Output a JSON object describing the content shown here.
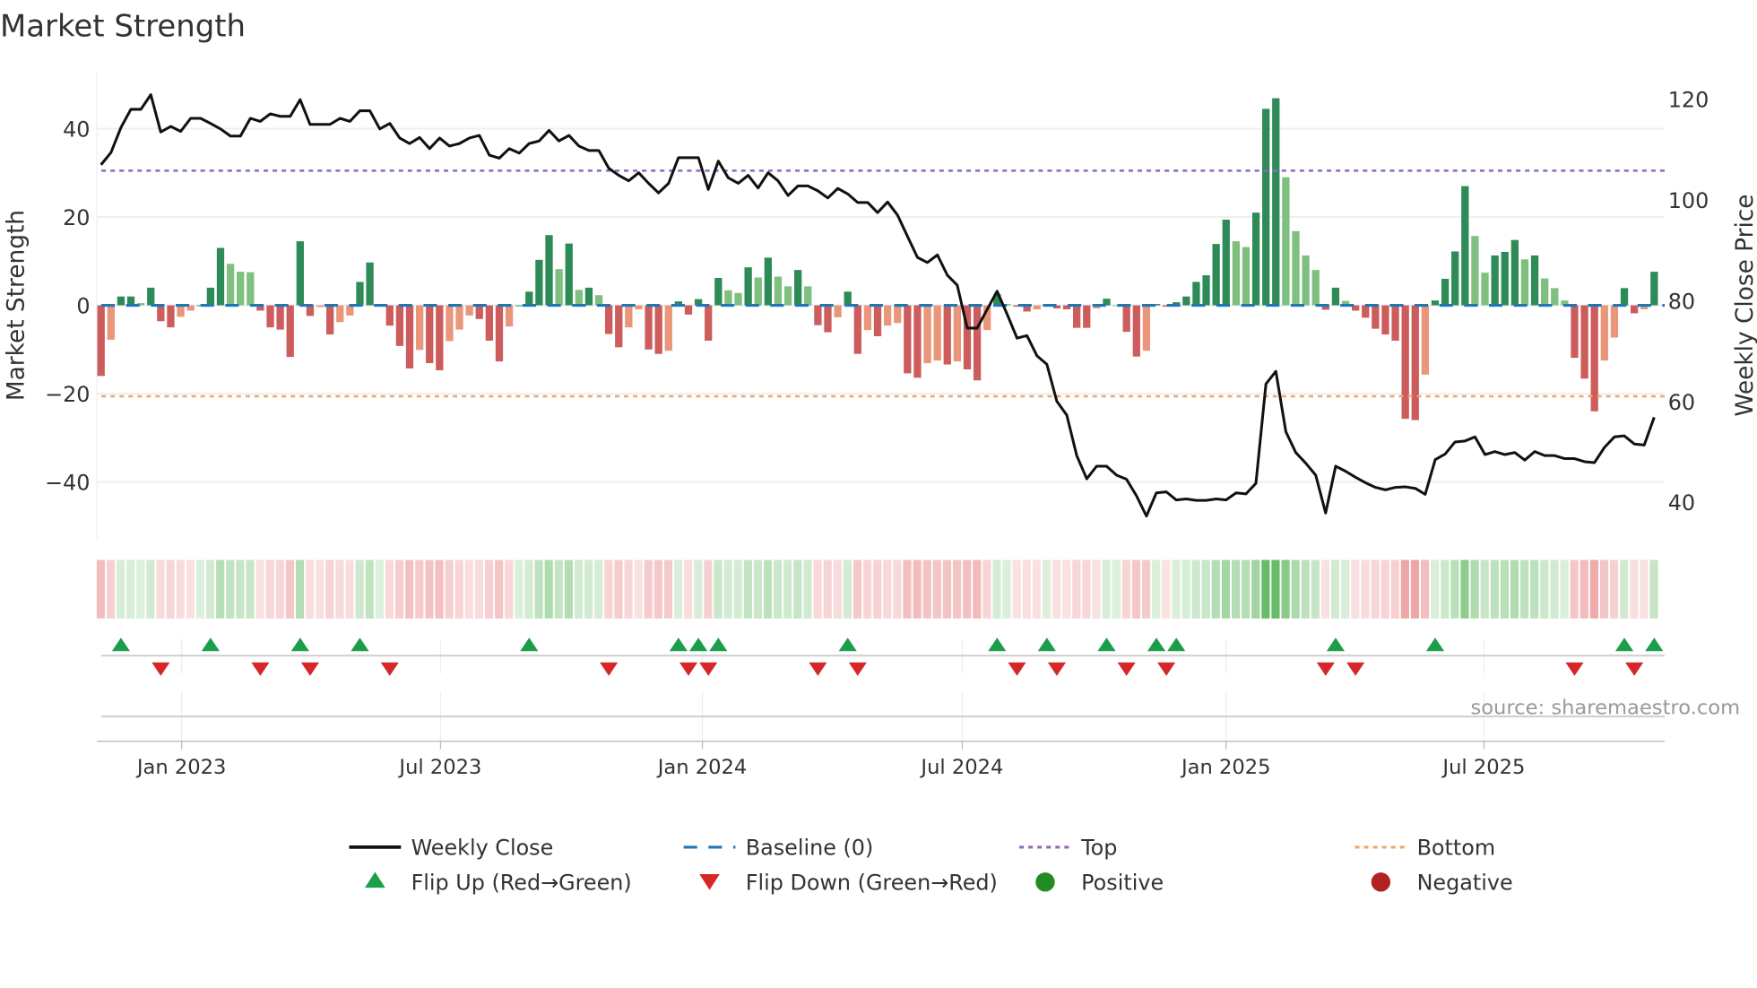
{
  "chart_data": {
    "type": "bar",
    "title": "Market Strength",
    "ylabel": "Market Strength",
    "y2label": "Weekly Close Price",
    "ylim": [
      -53,
      53
    ],
    "y2lim": [
      36,
      124
    ],
    "yticks": [
      40,
      20,
      0,
      -20,
      -40
    ],
    "yticks_labels": [
      "40",
      "20",
      "0",
      "−20",
      "−40"
    ],
    "y2ticks": [
      120,
      100,
      80,
      60,
      40
    ],
    "y2ticks_labels": [
      "120",
      "100",
      "80",
      "60",
      "40"
    ],
    "x_start": "2022-10-28",
    "x_interval": "weekly",
    "xticks": [
      {
        "label": "Jan 2023",
        "week": 9.1
      },
      {
        "label": "Jul 2023",
        "week": 35.1
      },
      {
        "label": "Jan 2024",
        "week": 61.4
      },
      {
        "label": "Jul 2024",
        "week": 87.5
      },
      {
        "label": "Jan 2025",
        "week": 114.0
      },
      {
        "label": "Jul 2025",
        "week": 139.9
      }
    ],
    "top_level": 30.5,
    "bottom_level": -20.6,
    "baseline": 0,
    "strength": [
      -16,
      -7.8,
      2,
      2,
      0.5,
      4,
      -3.6,
      -5,
      -2.6,
      -1.2,
      0,
      4,
      13,
      9.4,
      7.6,
      7.5,
      -1.2,
      -5,
      -5.5,
      -11.7,
      14.5,
      -2.4,
      -0.4,
      -6.6,
      -3.8,
      -2.3,
      5.3,
      9.7,
      0,
      -4.6,
      -9.2,
      -14.3,
      -10.1,
      -13.1,
      -14.7,
      -8.1,
      -5.5,
      -2.3,
      -3.1,
      -8,
      -12.7,
      -4.8,
      0,
      3.1,
      10.3,
      15.9,
      8.2,
      14,
      3.5,
      4,
      2.3,
      -6.5,
      -9.5,
      -5,
      -0.9,
      -10,
      -11,
      -10.3,
      0.9,
      -2.1,
      1.4,
      -8,
      6.2,
      3.4,
      2.8,
      8.6,
      6.3,
      10.8,
      6.5,
      4.3,
      8,
      4.3,
      -4.5,
      -6.1,
      -2.7,
      3.1,
      -11,
      -5.6,
      -7,
      -4.6,
      -4,
      -15.4,
      -16.4,
      -13.1,
      -12.5,
      -13.4,
      -12.7,
      -14.5,
      -17,
      -5.6,
      2.5,
      0.3,
      -0.3,
      -1.4,
      -0.9,
      0.3,
      -0.7,
      -0.9,
      -5.1,
      -5.1,
      -0.7,
      1.5,
      0,
      -6,
      -11.6,
      -10.3,
      0.3,
      -0.3,
      0.7,
      2,
      5.3,
      6.8,
      13.9,
      19.4,
      14.5,
      13.2,
      21,
      44.5,
      46.9,
      29,
      16.8,
      11.3,
      8,
      -1,
      4,
      1,
      -1.2,
      -2.8,
      -5.3,
      -6.6,
      -8,
      -25.7,
      -26,
      -15.7,
      1.1,
      6,
      12.2,
      27,
      15.7,
      7.4,
      11.3,
      12.1,
      14.8,
      10.4,
      11.3,
      6.1,
      3.9,
      1.1,
      -11.9,
      -16.6,
      -24,
      -12.5,
      -7.3,
      3.9,
      -1.8,
      -0.9,
      7.6
    ],
    "weekly_close": [
      107,
      109.4,
      114.4,
      118,
      118,
      120.9,
      113.5,
      114.6,
      113.6,
      116.2,
      116.2,
      115.2,
      114.1,
      112.7,
      112.7,
      116.2,
      115.6,
      117.1,
      116.6,
      116.6,
      119.9,
      115,
      115,
      115,
      116.2,
      115.6,
      117.7,
      117.7,
      114.1,
      115.2,
      112.3,
      111.2,
      112.4,
      110.2,
      112.3,
      110.7,
      111.2,
      112.3,
      112.8,
      108.9,
      108.3,
      110.2,
      109.3,
      111.2,
      111.7,
      113.8,
      111.7,
      112.8,
      110.7,
      109.8,
      109.8,
      106.3,
      104.9,
      103.8,
      105.4,
      103.3,
      101.4,
      103.3,
      108.4,
      108.4,
      108.4,
      102.1,
      107.7,
      104.4,
      103.3,
      104.9,
      102.4,
      105.4,
      103.8,
      100.9,
      102.8,
      102.8,
      101.8,
      100.4,
      102.3,
      101.2,
      99.5,
      99.5,
      97.5,
      99.6,
      97,
      92.8,
      88.6,
      87.6,
      89.1,
      85.1,
      83.1,
      74.6,
      74.6,
      78.3,
      81.9,
      77.4,
      72.6,
      73.1,
      69.1,
      67.4,
      60.1,
      57.3,
      49.3,
      44.7,
      47.2,
      47.2,
      45.4,
      44.6,
      41.3,
      37.3,
      41.9,
      42.1,
      40.5,
      40.7,
      40.4,
      40.4,
      40.7,
      40.5,
      41.9,
      41.7,
      43.8,
      63.5,
      66,
      54,
      49.9,
      47.8,
      45.4,
      37.9,
      47.2,
      46.2,
      45,
      43.9,
      43,
      42.5,
      43,
      43.1,
      42.8,
      41.6,
      48.5,
      49.6,
      52,
      52.2,
      53,
      49.5,
      50.1,
      49.5,
      49.9,
      48.4,
      50.1,
      49.3,
      49.3,
      48.7,
      48.7,
      48.1,
      47.9,
      50.9,
      53,
      53.2,
      51.6,
      51.4,
      56.9
    ],
    "flip_up_weeks": [
      3,
      12,
      21,
      27,
      44,
      59,
      61,
      63,
      76,
      91,
      96,
      102,
      107,
      109,
      125,
      135,
      154,
      157
    ],
    "flip_down_weeks": [
      7,
      17,
      22,
      30,
      52,
      60,
      62,
      73,
      77,
      93,
      97,
      104,
      108,
      124,
      127,
      149,
      155
    ],
    "legend": [
      {
        "label": "Weekly Close",
        "symbol": "line"
      },
      {
        "label": "Baseline (0)",
        "symbol": "dash"
      },
      {
        "label": "Top",
        "symbol": "dot-purple"
      },
      {
        "label": "Bottom",
        "symbol": "dot-orange"
      },
      {
        "label": "Flip Up (Red→Green)",
        "symbol": "triangle-up"
      },
      {
        "label": "Flip Down (Green→Red)",
        "symbol": "triangle-down"
      },
      {
        "label": "Positive",
        "symbol": "circle-green"
      },
      {
        "label": "Negative",
        "symbol": "circle-red"
      }
    ],
    "legend_position": "bottom"
  },
  "source": "source: sharemaestro.com",
  "colors": {
    "pos_dark": "#2e8b57",
    "pos_light": "#7fbf7f",
    "neg_dark": "#cd5c5c",
    "neg_light": "#e9967a",
    "line": "#111111",
    "baseline": "#1f77b4",
    "top": "#9467bd",
    "bottom": "#f4a460",
    "flip_up": "#1a9e4a",
    "flip_down": "#d62728",
    "positive": "#228b22",
    "negative": "#b22222"
  }
}
